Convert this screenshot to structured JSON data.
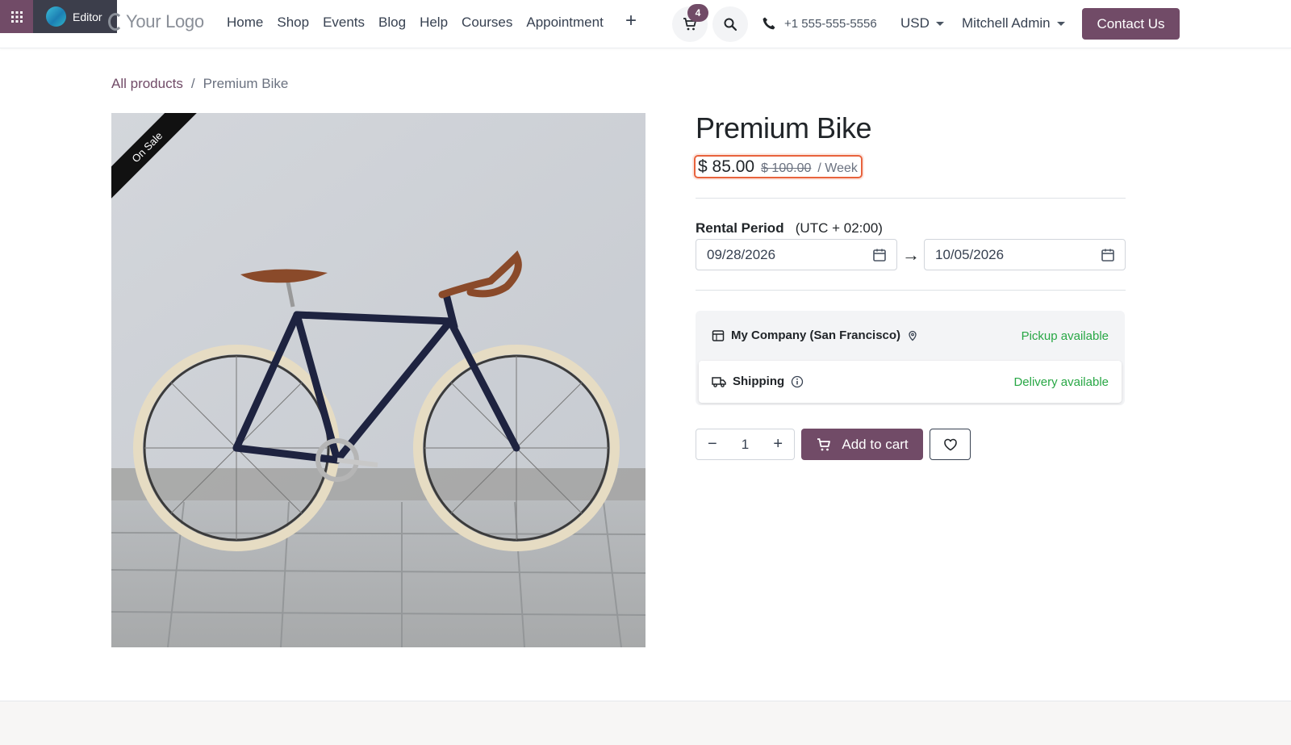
{
  "editor": {
    "label": "Editor"
  },
  "header": {
    "logo_text": "Your Logo",
    "menu": [
      "Home",
      "Shop",
      "Events",
      "Blog",
      "Help",
      "Courses",
      "Appointment"
    ],
    "add_menu_symbol": "+",
    "cart_count": "4",
    "phone": "+1 555-555-5556",
    "currency": "USD",
    "user": "Mitchell Admin",
    "contact_button": "Contact Us",
    "accent_color": "#714b67"
  },
  "breadcrumb": {
    "parent": "All products",
    "separator": "/",
    "current": "Premium Bike"
  },
  "product": {
    "ribbon": "On Sale",
    "title": "Premium Bike",
    "price": "$ 85.00",
    "old_price": "$ 100.00",
    "period": "/ Week",
    "rental_label": "Rental Period",
    "timezone": "(UTC + 02:00)",
    "start_date": "09/28/2026",
    "end_date": "10/05/2026",
    "arrow": "→"
  },
  "delivery": {
    "pickup_location": "My Company (San Francisco)",
    "pickup_status": "Pickup available",
    "shipping_label": "Shipping",
    "shipping_status": "Delivery available",
    "status_color": "#28a745"
  },
  "cart_controls": {
    "minus": "−",
    "quantity": "1",
    "plus": "+",
    "add_to_cart": "Add to cart"
  }
}
